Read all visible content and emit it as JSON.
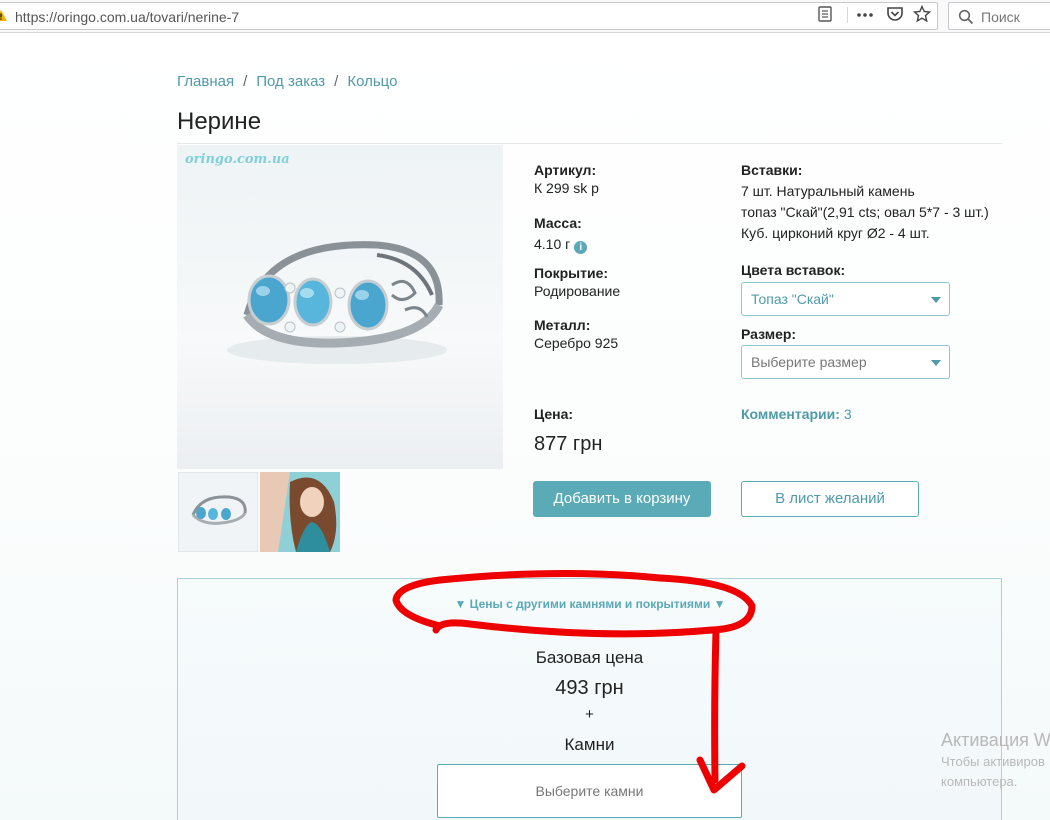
{
  "browser": {
    "url": "https://oringo.com.ua/tovari/nerine-7",
    "search_placeholder": "Поиск"
  },
  "breadcrumb": {
    "items": [
      "Главная",
      "Под заказ",
      "Кольцо"
    ],
    "separator": "/"
  },
  "product": {
    "title": "Нерине",
    "watermark": "oringo.com.ua",
    "article_label": "Артикул:",
    "article_value": "К 299 sk р",
    "mass_label": "Масса:",
    "mass_value": "4.10 г",
    "coating_label": "Покрытие:",
    "coating_value": "Родирование",
    "metal_label": "Металл:",
    "metal_value": "Серебро 925",
    "inserts_label": "Вставки:",
    "inserts_lines": [
      "7 шт. Натуральный камень",
      "топаз \"Скай\"(2,91 cts; овал 5*7 - 3 шт.)",
      "Куб. цирконий круг Ø2 - 4 шт."
    ],
    "insert_colors_label": "Цвета вставок:",
    "insert_colors_value": "Топаз \"Скай\"",
    "size_label": "Размер:",
    "size_placeholder": "Выберите размер",
    "price_label": "Цена:",
    "price_value": "877 грн",
    "comments_label": "Комментарии:",
    "comments_count": "3",
    "add_to_cart": "Добавить в корзину",
    "wishlist": "В лист желаний"
  },
  "price_box": {
    "toggle": "▼ Цены с другими камнями и покрытиями ▼",
    "base_label": "Базовая цена",
    "base_value": "493 грн",
    "plus": "+",
    "stones_label": "Камни",
    "stones_button": "Выберите камни"
  },
  "os_overlay": {
    "title": "Активация W",
    "line1": "Чтобы активиров",
    "line2": "компьютера."
  },
  "colors": {
    "accent": "#5aaab8",
    "link": "#4f9aaa",
    "annotation": "#ee0000"
  }
}
